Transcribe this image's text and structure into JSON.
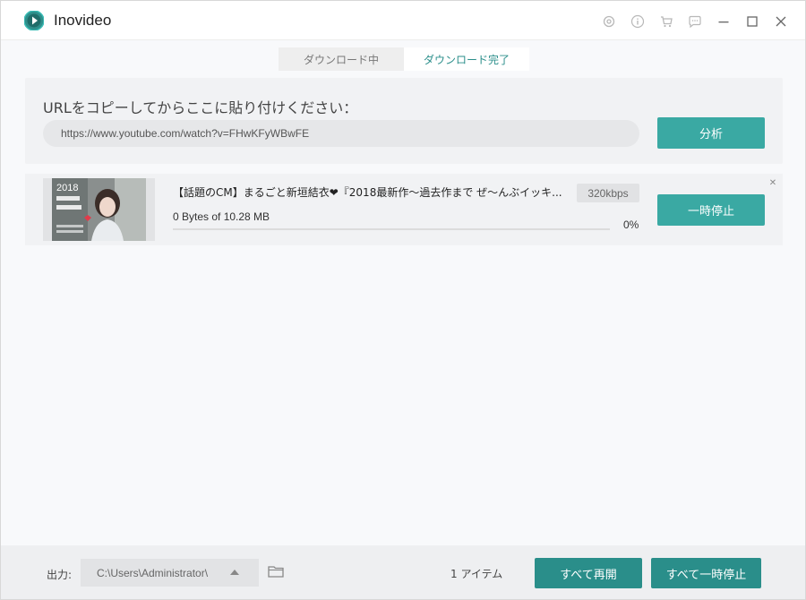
{
  "app": {
    "title": "Inovideo"
  },
  "tabs": [
    {
      "label": "ダウンロード中",
      "active": false
    },
    {
      "label": "ダウンロード完了",
      "active": true
    }
  ],
  "url_panel": {
    "label": "URLをコピーしてからここに貼り付けください：",
    "url_value": "https://www.youtube.com/watch?v=FHwKFyWBwFE",
    "analyze_label": "分析"
  },
  "downloads": [
    {
      "title": "【話題のCM】まるごと新垣結衣❤『2018最新作～過去作まで ぜ～んぶイッキ...",
      "bitrate": "320kbps",
      "size": "0 Bytes of 10.28 MB",
      "progress": 0,
      "percent": "0%",
      "pause_label": "一時停止",
      "thumbnail_text": "2018"
    }
  ],
  "bottom": {
    "output_label": "出力:",
    "output_path": "C:\\Users\\Administrator\\",
    "items_count": "1 アイテム",
    "resume_all_label": "すべて再開",
    "pause_all_label": "すべて一時停止"
  },
  "colors": {
    "accent": "#3aa9a3",
    "accent_dark": "#2a8e8a",
    "background": "#f8f9fb"
  },
  "icons": [
    "settings-icon",
    "info-icon",
    "cart-icon",
    "chat-icon",
    "minimize-icon",
    "maximize-icon",
    "close-icon",
    "folder-icon"
  ]
}
